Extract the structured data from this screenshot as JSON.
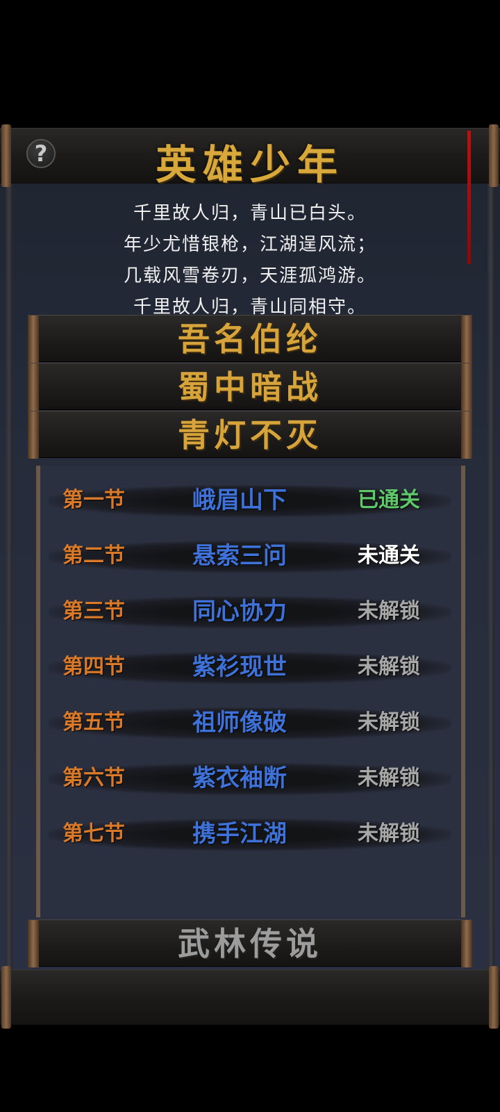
{
  "title": "英雄少年",
  "help_icon_glyph": "?",
  "poem": [
    "千里故人归，青山已白头。",
    "年少尤惜银枪，江湖逞风流；",
    "几载风雪卷刃，天涯孤鸿游。",
    "千里故人归，青山同相守。"
  ],
  "sections": [
    {
      "title": "吾名伯纶",
      "state": "unlocked"
    },
    {
      "title": "蜀中暗战",
      "state": "unlocked"
    },
    {
      "title": "青灯不灭",
      "state": "expanded"
    }
  ],
  "chapters": [
    {
      "num": "第一节",
      "name": "峨眉山下",
      "status": "已通关",
      "status_color": "#5fc86a"
    },
    {
      "num": "第二节",
      "name": "悬索三问",
      "status": "未通关",
      "status_color": "#ffffff"
    },
    {
      "num": "第三节",
      "name": "同心协力",
      "status": "未解锁",
      "status_color": "#a8a8a8"
    },
    {
      "num": "第四节",
      "name": "紫衫现世",
      "status": "未解锁",
      "status_color": "#a8a8a8"
    },
    {
      "num": "第五节",
      "name": "祖师像破",
      "status": "未解锁",
      "status_color": "#a8a8a8"
    },
    {
      "num": "第六节",
      "name": "紫衣袖断",
      "status": "未解锁",
      "status_color": "#a8a8a8"
    },
    {
      "num": "第七节",
      "name": "携手江湖",
      "status": "未解锁",
      "status_color": "#a8a8a8"
    }
  ],
  "locked_section": {
    "title": "武林传说",
    "state": "locked"
  },
  "colors": {
    "title_gold": "#d6a43a",
    "chapter_num": "#d97a2a",
    "chapter_name": "#3e72d8",
    "cleared": "#5fc86a",
    "locked": "#a8a8a8"
  }
}
